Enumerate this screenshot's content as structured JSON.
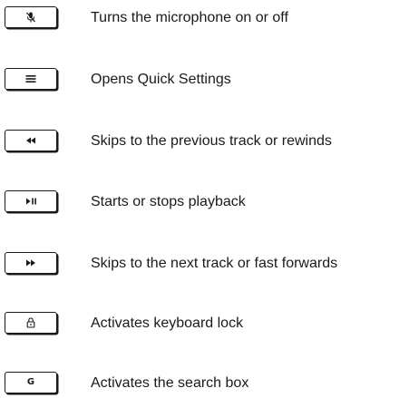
{
  "shortcuts": [
    {
      "key_icon": "mic-off-icon",
      "description": "Turns the microphone on or off"
    },
    {
      "key_icon": "menu-icon",
      "description": "Opens Quick Settings"
    },
    {
      "key_icon": "rewind-icon",
      "description": "Skips to the previous track or rewinds"
    },
    {
      "key_icon": "play-pause-icon",
      "description": "Starts or stops playback"
    },
    {
      "key_icon": "fast-forward-icon",
      "description": "Skips to the next track or fast forwards"
    },
    {
      "key_icon": "lock-icon",
      "description": "Activates keyboard lock"
    },
    {
      "key_icon": "google-g-icon",
      "key_label": "G",
      "description": "Activates the search box"
    }
  ]
}
